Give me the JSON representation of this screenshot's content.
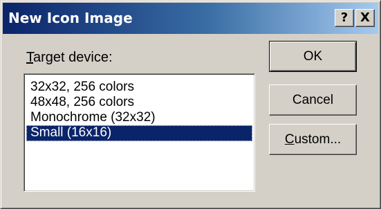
{
  "window": {
    "title": "New Icon Image",
    "help_label": "?",
    "close_label": "X"
  },
  "form": {
    "target_label_accel": "T",
    "target_label_rest": "arget device:"
  },
  "list": {
    "items": [
      {
        "label": "32x32, 256 colors",
        "selected": false
      },
      {
        "label": "48x48, 256 colors",
        "selected": false
      },
      {
        "label": "Monochrome (32x32)",
        "selected": false
      },
      {
        "label": "Small (16x16)",
        "selected": true
      }
    ]
  },
  "buttons": {
    "ok_label": "OK",
    "cancel_label": "Cancel",
    "custom_accel": "C",
    "custom_rest": "ustom..."
  },
  "colors": {
    "face": "#d4d0c8",
    "title_start": "#0a246a",
    "title_end": "#a6caf0",
    "selection": "#0a246a"
  }
}
